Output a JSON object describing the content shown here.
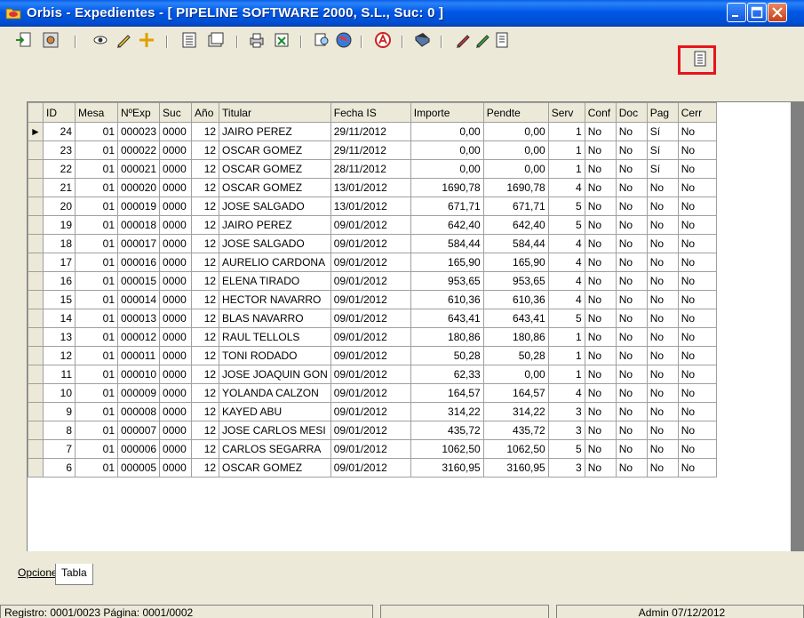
{
  "window": {
    "title": "Orbis - Expedientes - [ PIPELINE SOFTWARE 2000, S.L.,  Suc: 0 ]"
  },
  "toolbar": {
    "icons": [
      "import-icon",
      "settings-gear-icon",
      "view-eye-icon",
      "edit-pencil-icon",
      "add-plus-icon",
      "list-icon",
      "open-folder-icon",
      "print-icon",
      "excel-icon",
      "search-icon",
      "globe-icon",
      "acrobat-icon",
      "book-icon",
      "pencil-red-icon",
      "pencil-green-icon",
      "form-icon",
      "form-highlighted-icon"
    ]
  },
  "grid": {
    "columns": [
      "ID",
      "Mesa",
      "NºExp",
      "Suc",
      "Año",
      "Titular",
      "Fecha IS",
      "Importe",
      "Pendte",
      "Serv",
      "Conf",
      "Doc",
      "Pag",
      "Cerr"
    ],
    "rows": [
      [
        "24",
        "01",
        "000023",
        "0000",
        "12",
        "JAIRO PEREZ",
        "29/11/2012",
        "0,00",
        "0,00",
        "1",
        "No",
        "No",
        "Sí",
        "No"
      ],
      [
        "23",
        "01",
        "000022",
        "0000",
        "12",
        "OSCAR GOMEZ",
        "29/11/2012",
        "0,00",
        "0,00",
        "1",
        "No",
        "No",
        "Sí",
        "No"
      ],
      [
        "22",
        "01",
        "000021",
        "0000",
        "12",
        "OSCAR GOMEZ",
        "28/11/2012",
        "0,00",
        "0,00",
        "1",
        "No",
        "No",
        "Sí",
        "No"
      ],
      [
        "21",
        "01",
        "000020",
        "0000",
        "12",
        "OSCAR GOMEZ",
        "13/01/2012",
        "1690,78",
        "1690,78",
        "4",
        "No",
        "No",
        "No",
        "No"
      ],
      [
        "20",
        "01",
        "000019",
        "0000",
        "12",
        "JOSE SALGADO",
        "13/01/2012",
        "671,71",
        "671,71",
        "5",
        "No",
        "No",
        "No",
        "No"
      ],
      [
        "19",
        "01",
        "000018",
        "0000",
        "12",
        "JAIRO PEREZ",
        "09/01/2012",
        "642,40",
        "642,40",
        "5",
        "No",
        "No",
        "No",
        "No"
      ],
      [
        "18",
        "01",
        "000017",
        "0000",
        "12",
        "JOSE SALGADO",
        "09/01/2012",
        "584,44",
        "584,44",
        "4",
        "No",
        "No",
        "No",
        "No"
      ],
      [
        "17",
        "01",
        "000016",
        "0000",
        "12",
        "AURELIO CARDONA",
        "09/01/2012",
        "165,90",
        "165,90",
        "4",
        "No",
        "No",
        "No",
        "No"
      ],
      [
        "16",
        "01",
        "000015",
        "0000",
        "12",
        "ELENA TIRADO",
        "09/01/2012",
        "953,65",
        "953,65",
        "4",
        "No",
        "No",
        "No",
        "No"
      ],
      [
        "15",
        "01",
        "000014",
        "0000",
        "12",
        "HECTOR NAVARRO",
        "09/01/2012",
        "610,36",
        "610,36",
        "4",
        "No",
        "No",
        "No",
        "No"
      ],
      [
        "14",
        "01",
        "000013",
        "0000",
        "12",
        "BLAS NAVARRO",
        "09/01/2012",
        "643,41",
        "643,41",
        "5",
        "No",
        "No",
        "No",
        "No"
      ],
      [
        "13",
        "01",
        "000012",
        "0000",
        "12",
        "RAUL TELLOLS",
        "09/01/2012",
        "180,86",
        "180,86",
        "1",
        "No",
        "No",
        "No",
        "No"
      ],
      [
        "12",
        "01",
        "000011",
        "0000",
        "12",
        "TONI RODADO",
        "09/01/2012",
        "50,28",
        "50,28",
        "1",
        "No",
        "No",
        "No",
        "No"
      ],
      [
        "11",
        "01",
        "000010",
        "0000",
        "12",
        "JOSE JOAQUIN GON",
        "09/01/2012",
        "62,33",
        "0,00",
        "1",
        "No",
        "No",
        "No",
        "No"
      ],
      [
        "10",
        "01",
        "000009",
        "0000",
        "12",
        "YOLANDA CALZON",
        "09/01/2012",
        "164,57",
        "164,57",
        "4",
        "No",
        "No",
        "No",
        "No"
      ],
      [
        "9",
        "01",
        "000008",
        "0000",
        "12",
        "KAYED ABU",
        "09/01/2012",
        "314,22",
        "314,22",
        "3",
        "No",
        "No",
        "No",
        "No"
      ],
      [
        "8",
        "01",
        "000007",
        "0000",
        "12",
        "JOSE CARLOS MESI",
        "09/01/2012",
        "435,72",
        "435,72",
        "3",
        "No",
        "No",
        "No",
        "No"
      ],
      [
        "7",
        "01",
        "000006",
        "0000",
        "12",
        "CARLOS SEGARRA",
        "09/01/2012",
        "1062,50",
        "1062,50",
        "5",
        "No",
        "No",
        "No",
        "No"
      ],
      [
        "6",
        "01",
        "000005",
        "0000",
        "12",
        "OSCAR GOMEZ",
        "09/01/2012",
        "3160,95",
        "3160,95",
        "3",
        "No",
        "No",
        "No",
        "No"
      ]
    ],
    "current_row_marker": "►"
  },
  "tabs": {
    "opciones": "Opciones",
    "tabla": "Tabla"
  },
  "status": {
    "registro": "Registro: 0001/0023  Página: 0001/0002",
    "middle": "",
    "user": "Admin 07/12/2012"
  },
  "colors": {
    "highlight": "#e8141c",
    "titlebar": "#0058e6"
  }
}
